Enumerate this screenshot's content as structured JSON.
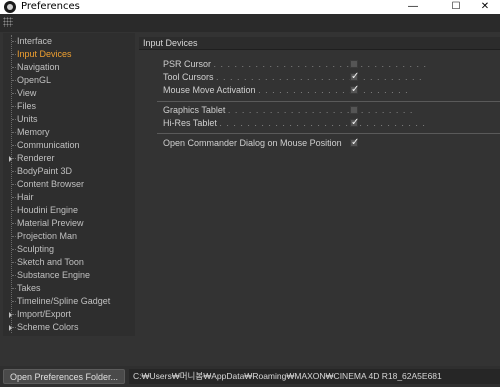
{
  "window": {
    "title": "Preferences",
    "minimize_glyph": "—",
    "maximize_glyph": "☐",
    "close_glyph": "✕"
  },
  "sidebar": {
    "items": [
      {
        "label": "Interface",
        "active": false,
        "expandable": false
      },
      {
        "label": "Input Devices",
        "active": true,
        "expandable": false
      },
      {
        "label": "Navigation",
        "active": false,
        "expandable": false
      },
      {
        "label": "OpenGL",
        "active": false,
        "expandable": false
      },
      {
        "label": "View",
        "active": false,
        "expandable": false
      },
      {
        "label": "Files",
        "active": false,
        "expandable": false
      },
      {
        "label": "Units",
        "active": false,
        "expandable": false
      },
      {
        "label": "Memory",
        "active": false,
        "expandable": false
      },
      {
        "label": "Communication",
        "active": false,
        "expandable": false
      },
      {
        "label": "Renderer",
        "active": false,
        "expandable": true
      },
      {
        "label": "BodyPaint 3D",
        "active": false,
        "expandable": false
      },
      {
        "label": "Content Browser",
        "active": false,
        "expandable": false
      },
      {
        "label": "Hair",
        "active": false,
        "expandable": false
      },
      {
        "label": "Houdini Engine",
        "active": false,
        "expandable": false
      },
      {
        "label": "Material Preview",
        "active": false,
        "expandable": false
      },
      {
        "label": "Projection Man",
        "active": false,
        "expandable": false
      },
      {
        "label": "Sculpting",
        "active": false,
        "expandable": false
      },
      {
        "label": "Sketch and Toon",
        "active": false,
        "expandable": false
      },
      {
        "label": "Substance Engine",
        "active": false,
        "expandable": false
      },
      {
        "label": "Takes",
        "active": false,
        "expandable": false
      },
      {
        "label": "Timeline/Spline Gadget",
        "active": false,
        "expandable": false
      },
      {
        "label": "Import/Export",
        "active": false,
        "expandable": true
      },
      {
        "label": "Scheme Colors",
        "active": false,
        "expandable": true
      }
    ]
  },
  "panel": {
    "title": "Input Devices",
    "options": [
      {
        "label": "PSR Cursor",
        "dots": ". . . . . . . . . . . . . . . . . . . . . . . . . . . . . . .",
        "checked": false
      },
      {
        "label": "Tool Cursors",
        "dots": ". . . . . . . . . . . . . . . . . . . . . . . . . . . . . .",
        "checked": true
      },
      {
        "label": "Mouse Move Activation",
        "dots": ". . . . . . . . . . . . . . . . . . . . . .",
        "checked": true
      },
      {
        "label": "Graphics Tablet",
        "dots": ". . . . . . . . . . . . . . . . . . . . . . . . . . .",
        "checked": false
      },
      {
        "label": "Hi-Res Tablet",
        "dots": ". . . . . . . . . . . . . . . . . . . . . . . . . . . . . .",
        "checked": true
      },
      {
        "label": "Open Commander Dialog on Mouse Position",
        "dots": "",
        "checked": true
      }
    ]
  },
  "footer": {
    "open_button_label": "Open Preferences Folder...",
    "path": "C:₩Users₩머니봄₩AppData₩Roaming₩MAXON₩CINEMA 4D R18_62A5E681"
  }
}
